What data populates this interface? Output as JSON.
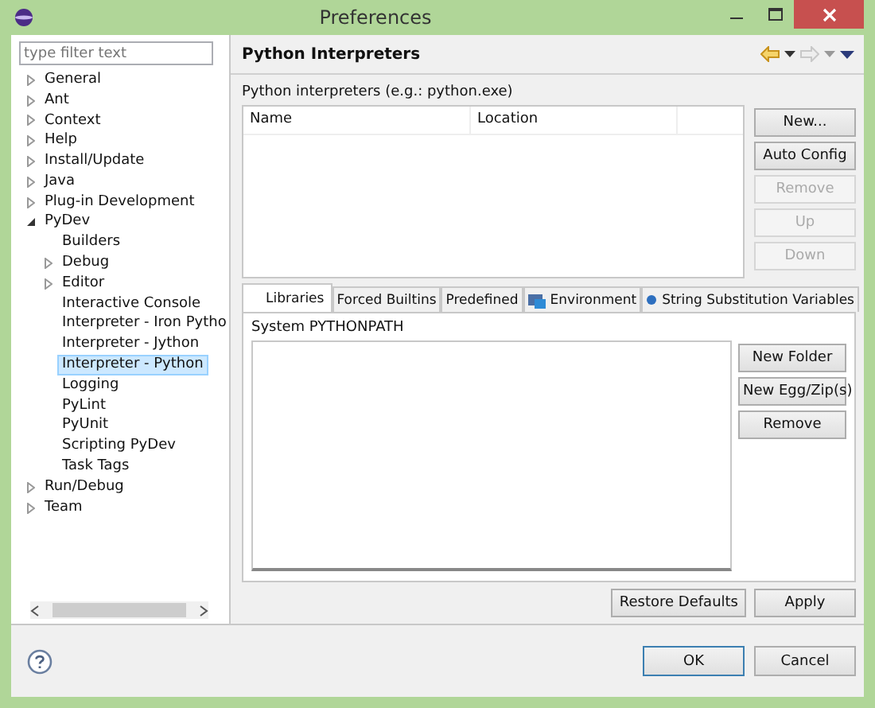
{
  "window": {
    "title": "Preferences"
  },
  "filter": {
    "placeholder": "type filter text"
  },
  "tree": [
    {
      "label": "General",
      "expanded": false,
      "selected": false
    },
    {
      "label": "Ant",
      "expanded": false,
      "selected": false
    },
    {
      "label": "Context",
      "expanded": false,
      "selected": false
    },
    {
      "label": "Help",
      "expanded": false,
      "selected": false
    },
    {
      "label": "Install/Update",
      "expanded": false,
      "selected": false
    },
    {
      "label": "Java",
      "expanded": false,
      "selected": false
    },
    {
      "label": "Plug-in Development",
      "expanded": false,
      "selected": false
    },
    {
      "label": "PyDev",
      "expanded": true,
      "selected": false,
      "children": [
        {
          "label": "Builders",
          "selected": false
        },
        {
          "label": "Debug",
          "expanded": false,
          "selected": false
        },
        {
          "label": "Editor",
          "expanded": false,
          "selected": false
        },
        {
          "label": "Interactive Console",
          "selected": false
        },
        {
          "label": "Interpreter - Iron Pytho",
          "selected": false
        },
        {
          "label": "Interpreter - Jython",
          "selected": false
        },
        {
          "label": "Interpreter - Python",
          "selected": true
        },
        {
          "label": "Logging",
          "selected": false
        },
        {
          "label": "PyLint",
          "selected": false
        },
        {
          "label": "PyUnit",
          "selected": false
        },
        {
          "label": "Scripting PyDev",
          "selected": false
        },
        {
          "label": "Task Tags",
          "selected": false
        }
      ]
    },
    {
      "label": "Run/Debug",
      "expanded": false,
      "selected": false
    },
    {
      "label": "Team",
      "expanded": false,
      "selected": false
    }
  ],
  "page": {
    "title": "Python Interpreters",
    "subtitle": "Python interpreters (e.g.: python.exe)",
    "table": {
      "columns": [
        "Name",
        "Location"
      ]
    },
    "side_buttons": [
      {
        "label": "New...",
        "disabled": false
      },
      {
        "label": "Auto Config",
        "disabled": false
      },
      {
        "label": "Remove",
        "disabled": true
      },
      {
        "label": "Up",
        "disabled": true
      },
      {
        "label": "Down",
        "disabled": true
      }
    ],
    "tabs": [
      {
        "label": "Libraries",
        "selected": true,
        "kind": "plain"
      },
      {
        "label": "Forced Builtins",
        "selected": false,
        "kind": "plain"
      },
      {
        "label": "Predefined",
        "selected": false,
        "kind": "plain"
      },
      {
        "label": "Environment",
        "selected": false,
        "kind": "environment"
      },
      {
        "label": "String Substitution Variables",
        "selected": false,
        "kind": "variables"
      }
    ],
    "path_label": "System PYTHONPATH",
    "path_buttons": [
      "New Folder",
      "New Egg/Zip(s)",
      "Remove"
    ],
    "page_buttons": [
      "Restore Defaults",
      "Apply"
    ]
  },
  "buttons": [
    {
      "label": "OK",
      "default": true
    },
    {
      "label": "Cancel",
      "default": false
    }
  ]
}
